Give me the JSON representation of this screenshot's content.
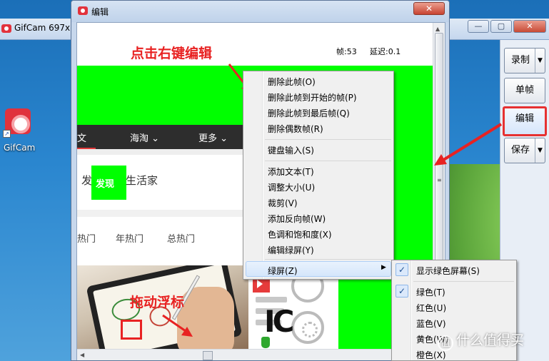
{
  "gifcam": {
    "title": "GifCam 697x",
    "buttons": {
      "record": "录制",
      "single": "单帧",
      "edit": "编辑",
      "save": "保存"
    },
    "controls": {
      "minimize": "—",
      "maximize": "▢",
      "close": "✕"
    }
  },
  "desktop": {
    "icon_label": "GifCam"
  },
  "editor": {
    "title": "编辑",
    "close": "✕",
    "frame_label": "帧:53",
    "delay_label": "延迟:0.1",
    "content": {
      "nav": [
        "文",
        "海淘",
        "更多"
      ],
      "find": "发现",
      "find_badge": "发现",
      "life": "生活家",
      "hot_tabs": [
        "热门",
        "年热门",
        "总热门"
      ],
      "big_text": "IC"
    }
  },
  "annotations": {
    "right_click": "点击右键编辑",
    "drag": "拖动浮标"
  },
  "context_menu": {
    "group1": [
      "删除此帧(O)",
      "删除此帧到开始的帧(P)",
      "删除此帧到最后帧(Q)",
      "删除偶数帧(R)"
    ],
    "group2": [
      "键盘输入(S)"
    ],
    "group3": [
      "添加文本(T)",
      "调整大小(U)",
      "裁剪(V)",
      "添加反向帧(W)",
      "色调和饱和度(X)",
      "编辑绿屏(Y)"
    ],
    "greenscreen": "绿屏(Z)"
  },
  "submenu": {
    "show": "显示绿色屏幕(S)",
    "colors": [
      "绿色(T)",
      "红色(U)",
      "蓝色(V)",
      "黄色(W)",
      "橙色(X)"
    ]
  },
  "watermark": {
    "badge": "值",
    "text": "什么值得买"
  },
  "colors": {
    "accent_red": "#e82222",
    "chroma_green": "#00ff00"
  },
  "icons": [
    "gifcam-logo-icon",
    "check-icon",
    "submenu-arrow-icon",
    "scroll-arrow-icon"
  ]
}
